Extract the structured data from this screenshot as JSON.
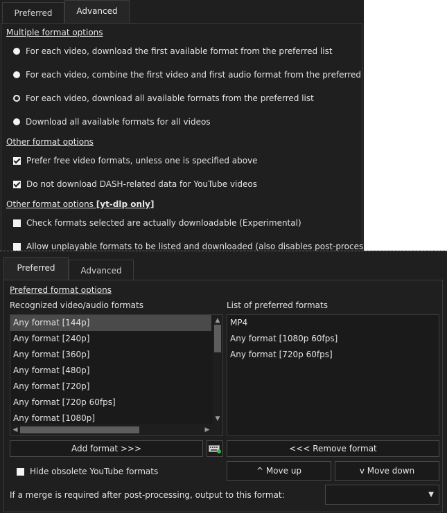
{
  "top_panel": {
    "tabs": [
      "Preferred",
      "Advanced"
    ],
    "active_tab": "Advanced",
    "multiple_section": "Multiple format options",
    "multiple_options": [
      {
        "label": "For each video, download the first available format from the preferred list",
        "selected": false
      },
      {
        "label": "For each video, combine the first video and first audio format from the preferred list",
        "selected": false
      },
      {
        "label": "For each video, download all available formats from the preferred list",
        "selected": true
      },
      {
        "label": "Download all available formats for all videos",
        "selected": false
      }
    ],
    "other_section": "Other format options",
    "other_options": [
      {
        "label": "Prefer free video formats, unless one is specified above",
        "checked": true
      },
      {
        "label": "Do not download DASH-related data for YouTube videos",
        "checked": true
      }
    ],
    "ytdlp_section": "Other format options",
    "ytdlp_suffix": "[yt-dlp only]",
    "ytdlp_options": [
      {
        "label": "Check formats selected are actually downloadable (Experimental)",
        "checked": false
      },
      {
        "label": "Allow unplayable formats to be listed and downloaded (also disables post-processing)",
        "checked": false
      }
    ]
  },
  "bottom_panel": {
    "tabs": [
      "Preferred",
      "Advanced"
    ],
    "active_tab": "Preferred",
    "section": "Preferred format options",
    "recognized_label": "Recognized video/audio formats",
    "preferred_label": "List of preferred formats",
    "recognized_formats": [
      "Any format [144p]",
      "Any format [240p]",
      "Any format [360p]",
      "Any format [480p]",
      "Any format [720p]",
      "Any format [720p 60fps]",
      "Any format [1080p]"
    ],
    "selected_recognized": "Any format [144p]",
    "preferred_formats": [
      "MP4",
      "Any format [1080p 60fps]",
      "Any format [720p 60fps]"
    ],
    "add_button": "Add format >>>",
    "remove_button": "<<< Remove format",
    "move_up_button": "^ Move up",
    "move_down_button": "v Move down",
    "hide_obsolete": {
      "label": "Hide obsolete YouTube formats",
      "checked": false
    },
    "merge_label": "If a merge is required after post-processing, output to this format:",
    "merge_value": ""
  },
  "icons": [
    "keyboard-icon",
    "chevron-down-icon",
    "scroll-up-icon",
    "scroll-down-icon",
    "scroll-left-icon",
    "scroll-right-icon"
  ]
}
